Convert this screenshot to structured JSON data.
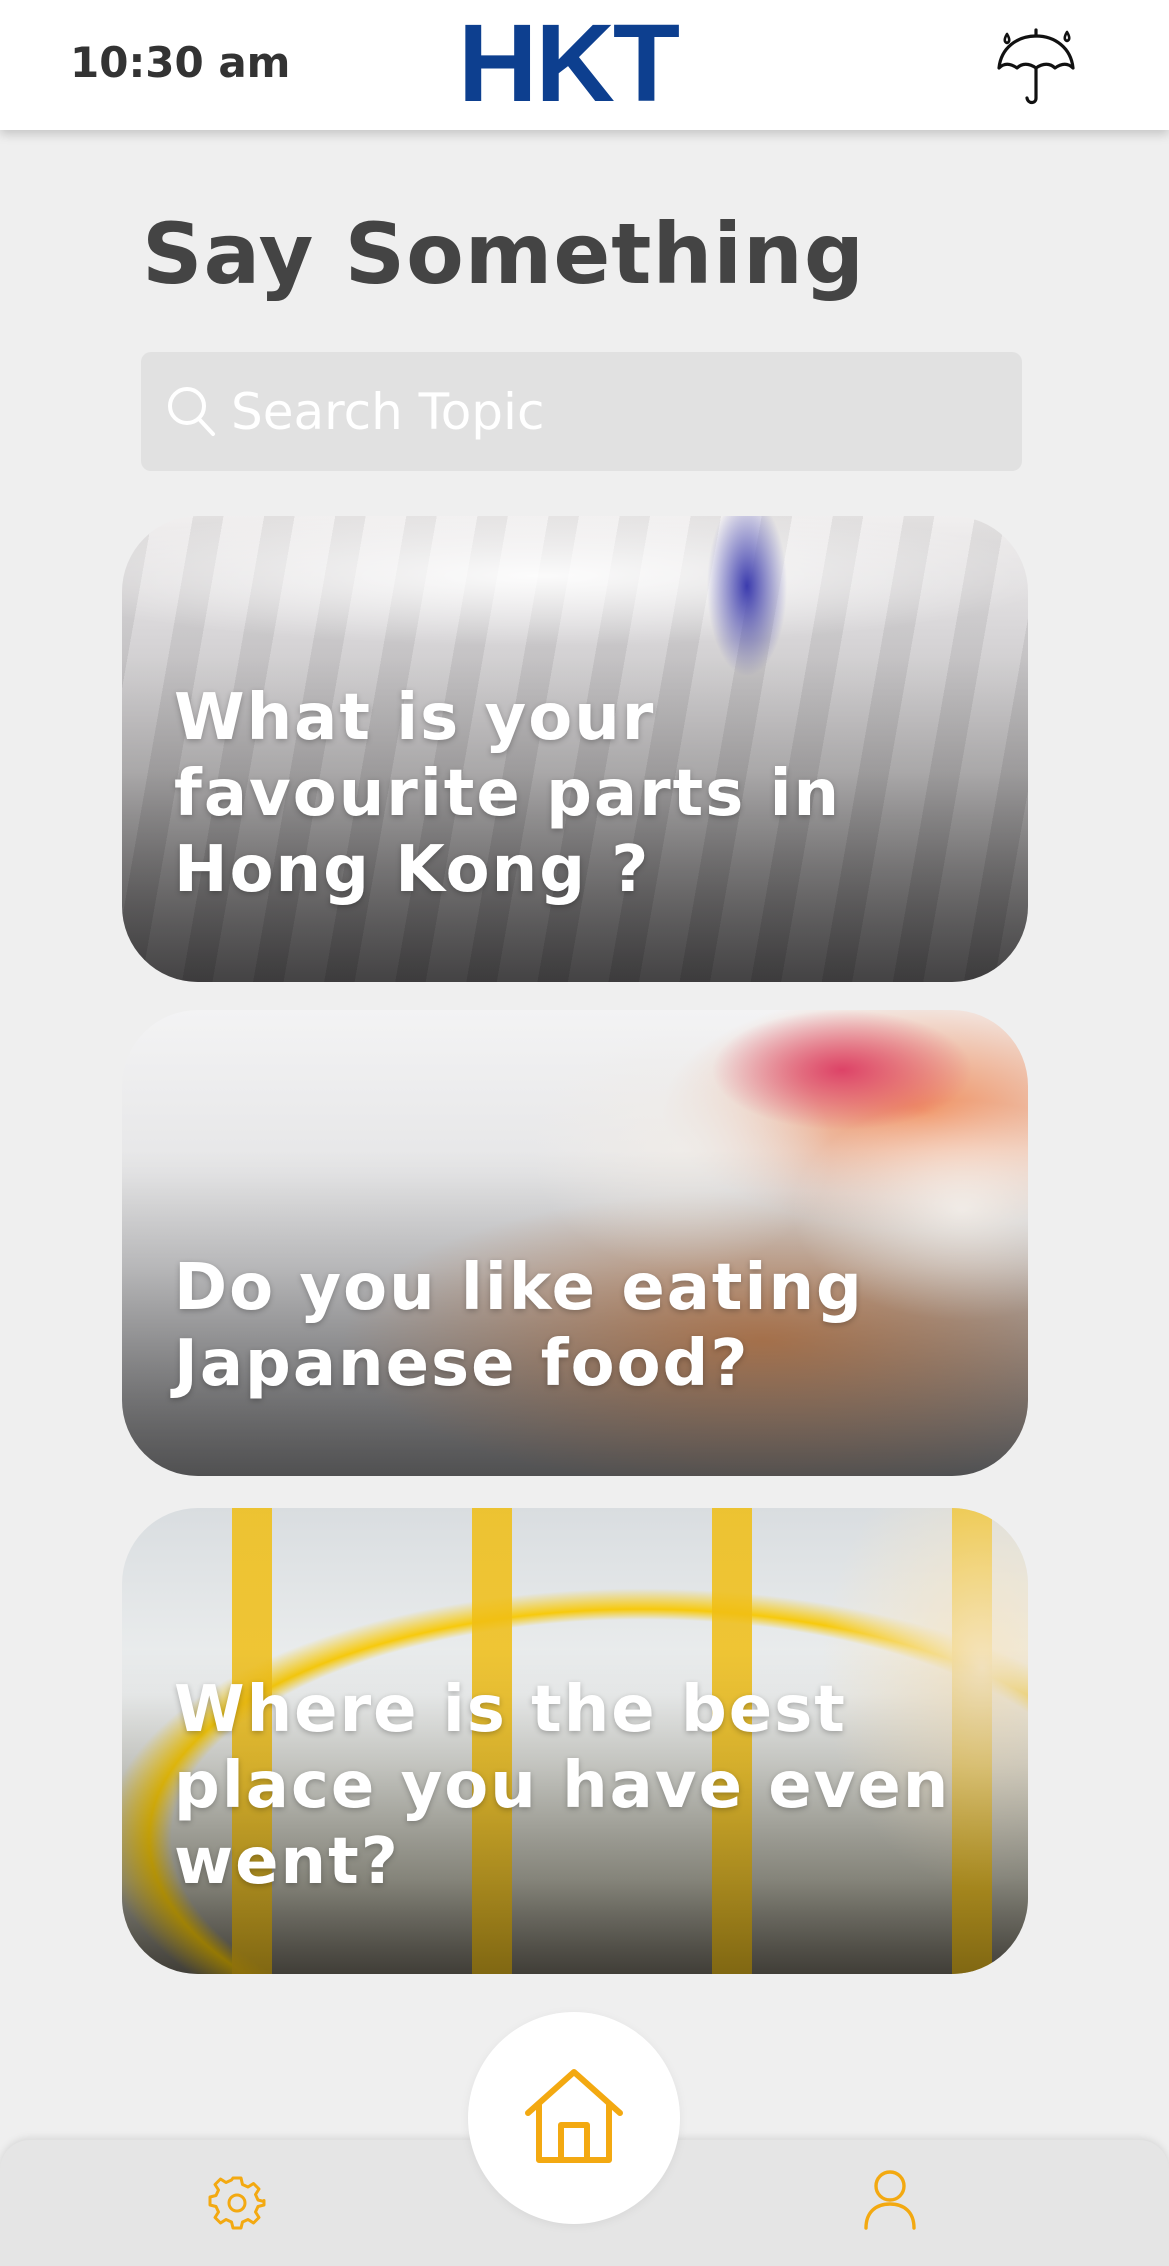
{
  "status_bar": {
    "time": "10:30 am",
    "logo": "HKT",
    "weather_icon": "umbrella-rain-icon"
  },
  "page": {
    "title": "Say Something"
  },
  "search": {
    "placeholder": "Search Topic",
    "value": ""
  },
  "topics": [
    {
      "title": "What is your favourite parts in Hong Kong ?"
    },
    {
      "title": "Do you like eating Japanese food?"
    },
    {
      "title": "Where is the best place you have even went?"
    }
  ],
  "bottom_nav": {
    "items": [
      {
        "icon": "gear-icon"
      },
      {
        "icon": "home-icon"
      },
      {
        "icon": "user-icon"
      }
    ]
  },
  "colors": {
    "brand_blue": "#0d3f8f",
    "accent_orange": "#f3a911",
    "background": "#efefef",
    "search_bg": "#e1e1e1"
  }
}
